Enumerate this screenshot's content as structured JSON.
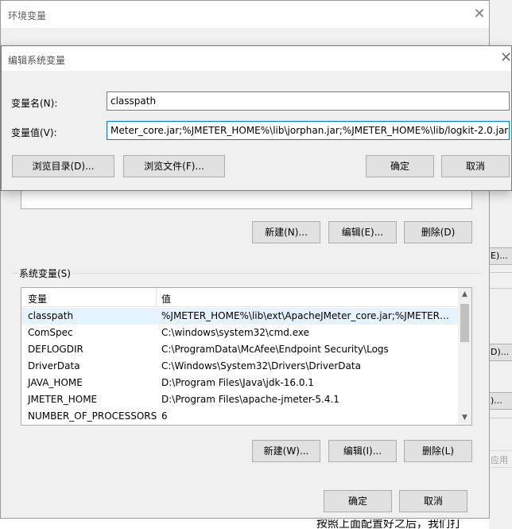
{
  "env_window": {
    "title": "环境变量",
    "user_buttons": {
      "new": "新建(N)...",
      "edit": "编辑(E)...",
      "delete": "删除(D)"
    },
    "system_group_label": "系统变量(S)",
    "system_columns": {
      "name": "变量",
      "value": "值"
    },
    "system_rows": [
      {
        "name": "classpath",
        "value": "%JMETER_HOME%\\lib\\ext\\ApacheJMeter_core.jar;%JMETER_...",
        "selected": true
      },
      {
        "name": "ComSpec",
        "value": "C:\\windows\\system32\\cmd.exe",
        "selected": false
      },
      {
        "name": "DEFLOGDIR",
        "value": "C:\\ProgramData\\McAfee\\Endpoint Security\\Logs",
        "selected": false
      },
      {
        "name": "DriverData",
        "value": "C:\\Windows\\System32\\Drivers\\DriverData",
        "selected": false
      },
      {
        "name": "JAVA_HOME",
        "value": "D:\\Program Files\\Java\\jdk-16.0.1",
        "selected": false
      },
      {
        "name": "JMETER_HOME",
        "value": "D:\\Program Files\\apache-jmeter-5.4.1",
        "selected": false
      },
      {
        "name": "NUMBER_OF_PROCESSORS",
        "value": "6",
        "selected": false
      }
    ],
    "system_buttons": {
      "new": "新建(W)...",
      "edit": "编辑(I)...",
      "delete": "删除(L)"
    },
    "ok": "确定",
    "cancel": "取消"
  },
  "edit_dialog": {
    "title": "编辑系统变量",
    "name_label": "变量名(N):",
    "name_value": "classpath",
    "value_label": "变量值(V):",
    "value_value": "Meter_core.jar;%JMETER_HOME%\\lib\\jorphan.jar;%JMETER_HOME%\\lib/logkit-2.0.jar;",
    "browse_dir": "浏览目录(D)...",
    "browse_file": "浏览文件(F)...",
    "ok": "确定",
    "cancel": "取消"
  },
  "background": {
    "strip_labels": [
      "E)...",
      "D)...",
      ")...",
      "应用"
    ],
    "bottom_text": "按照上面配置好之后，我们打"
  }
}
